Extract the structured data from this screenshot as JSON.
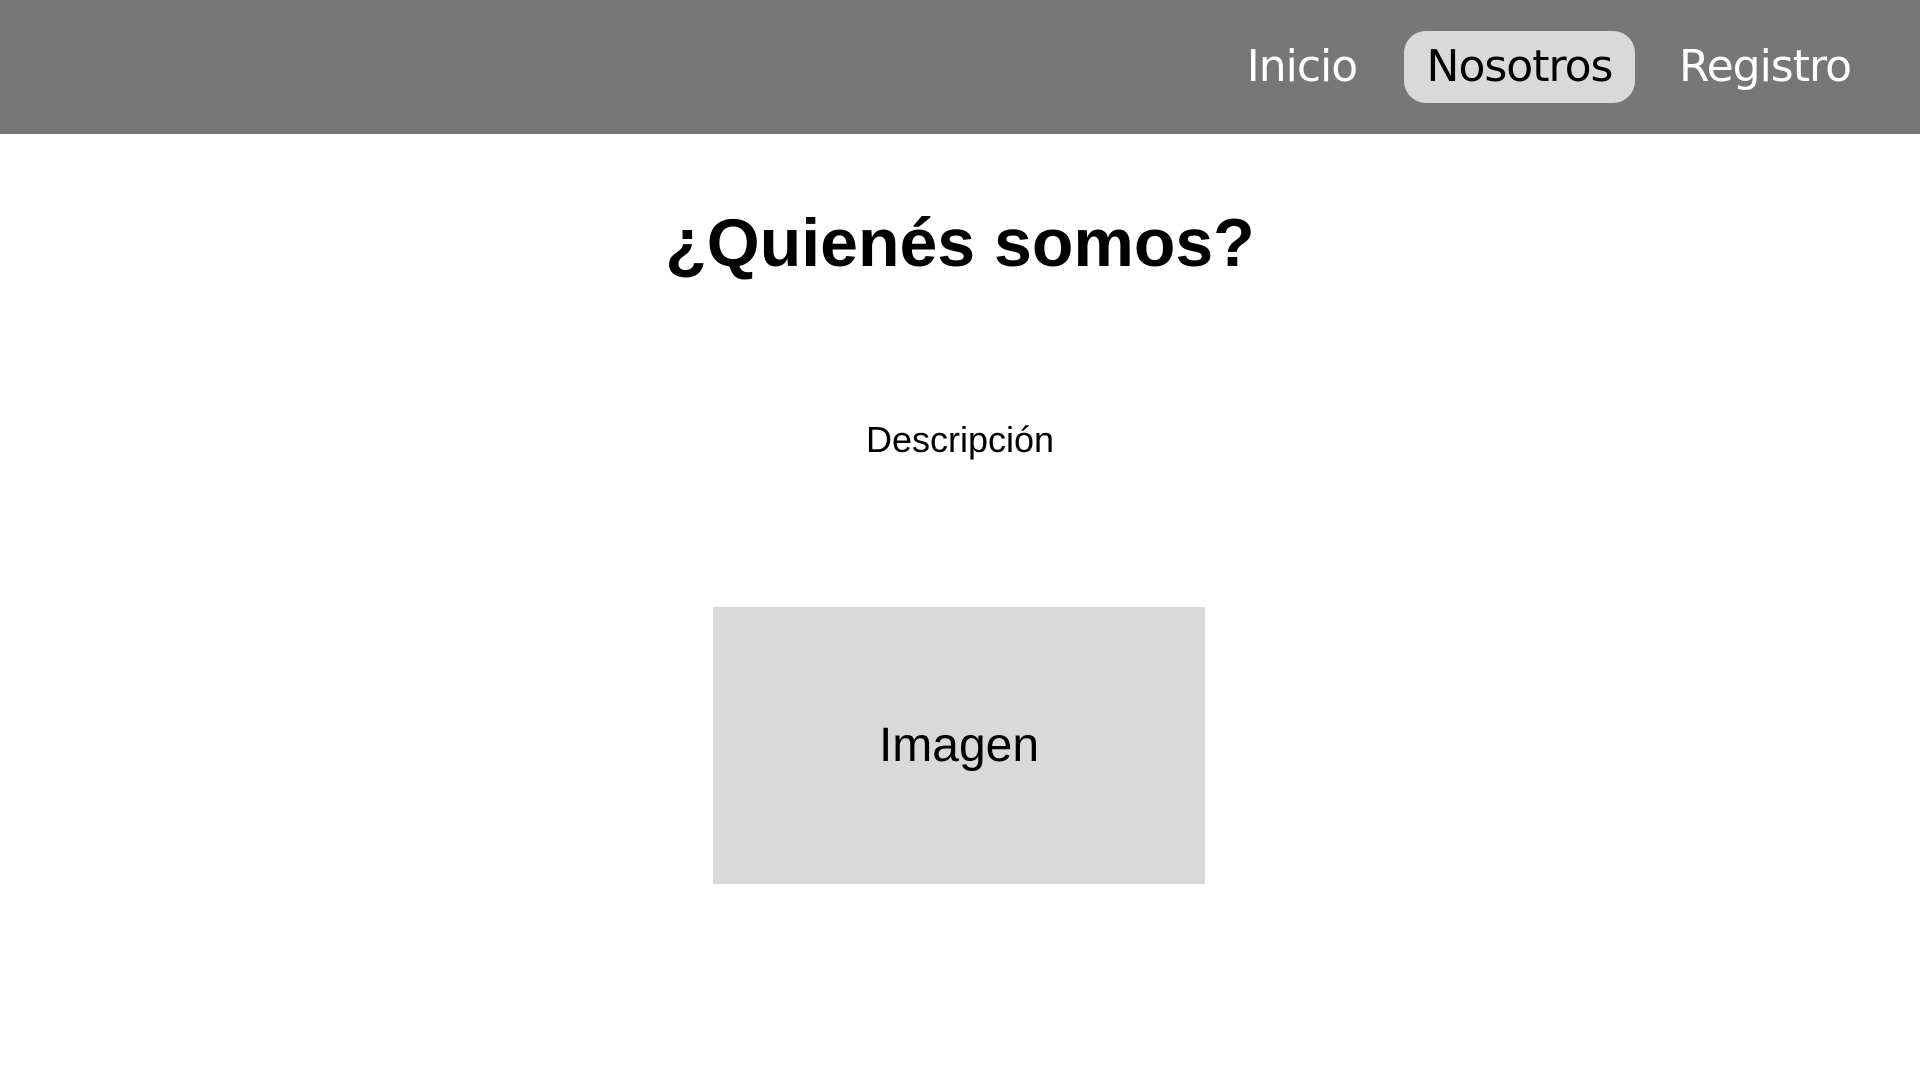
{
  "nav": {
    "items": [
      {
        "label": "Inicio"
      },
      {
        "label": "Nosotros",
        "active": true
      },
      {
        "label": "Registro"
      }
    ],
    "bar_color": "#777777",
    "active_color": "#d9d9d9"
  },
  "main": {
    "title": "¿Quienés somos?",
    "description": "Descripción",
    "image_placeholder_label": "Imagen"
  }
}
